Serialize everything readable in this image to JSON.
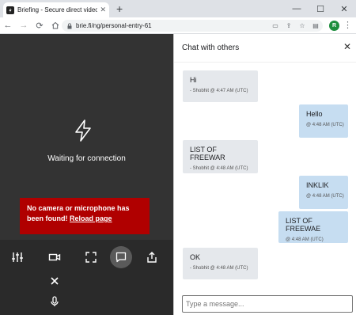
{
  "browser": {
    "tab_title": "Briefing - Secure direct video co",
    "url": "brie.fi/ng/personal-entry-61",
    "profile_initial": "R"
  },
  "video": {
    "status": "Waiting for connection",
    "alert_text": "No camera or microphone has been found!",
    "alert_link": "Reload page"
  },
  "chat": {
    "title": "Chat with others",
    "input_placeholder": "Type a message...",
    "messages": [
      {
        "text": "Hi",
        "meta": "- Shobhit @ 4:47 AM (UTC)",
        "dir": "in"
      },
      {
        "text": "Hello",
        "meta": "@ 4:48 AM (UTC)",
        "dir": "out"
      },
      {
        "text": "LIST OF FREEWAR",
        "meta": "- Shobhit @ 4:48 AM (UTC)",
        "dir": "in"
      },
      {
        "text": "INKLIK",
        "meta": "@ 4:48 AM (UTC)",
        "dir": "out"
      },
      {
        "text": "LIST OF FREEWAE",
        "meta": "@ 4:48 AM (UTC)",
        "dir": "out"
      },
      {
        "text": "OK",
        "meta": "- Shobhit @ 4:48 AM (UTC)",
        "dir": "in"
      }
    ]
  },
  "colors": {
    "alert_bg": "#b00000",
    "incoming_bubble": "#e5e8ec",
    "outgoing_bubble": "#c6ddf1"
  }
}
